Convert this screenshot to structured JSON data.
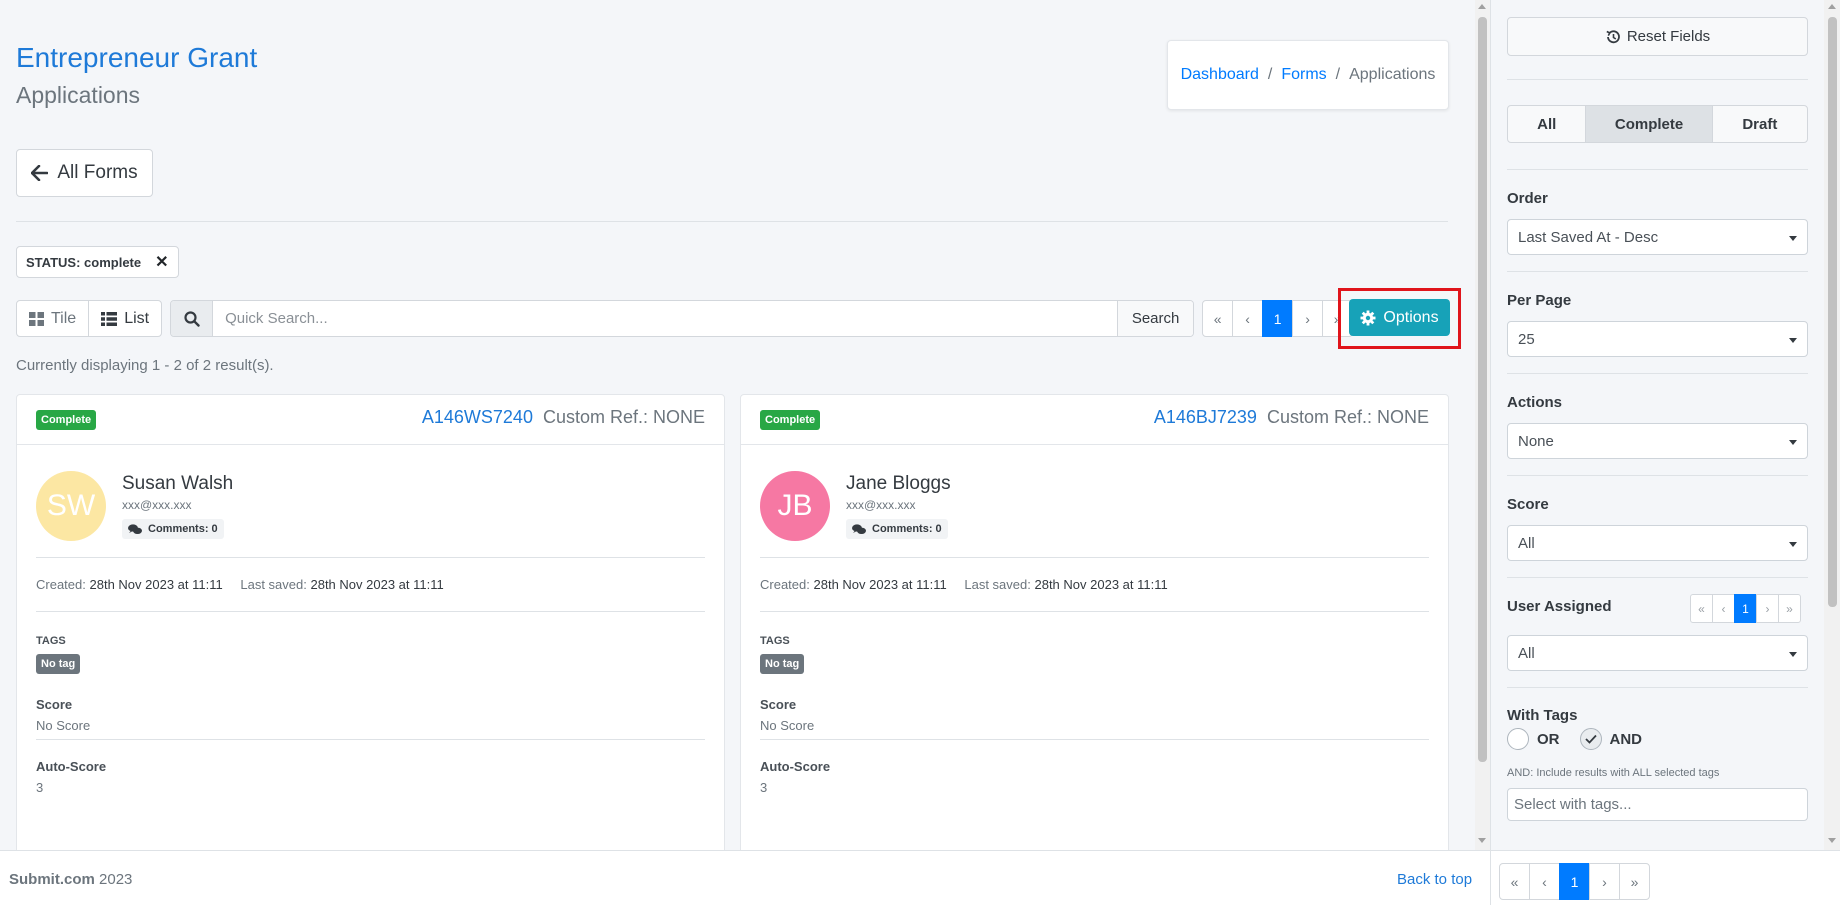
{
  "header": {
    "title": "Entrepreneur Grant",
    "subtitle": "Applications"
  },
  "breadcrumb": {
    "items": [
      "Dashboard",
      "Forms",
      "Applications"
    ]
  },
  "back_button": {
    "label": "All Forms"
  },
  "status_filter": {
    "label": "STATUS:",
    "value": "complete"
  },
  "toolbar": {
    "tile_label": "Tile",
    "list_label": "List",
    "search_placeholder": "Quick Search...",
    "search_button": "Search",
    "options_label": "Options",
    "pager": [
      "«",
      "‹",
      "1",
      "›",
      "»"
    ]
  },
  "results": {
    "summary": "Currently displaying 1 - 2 of 2 result(s)."
  },
  "cards": [
    {
      "status": "Complete",
      "ref": "A146WS7240",
      "custom_ref": "Custom Ref.: NONE",
      "initials": "SW",
      "avatar_color": "#fce7a3",
      "name": "Susan Walsh",
      "email": "xxx@xxx.xxx",
      "comments": "Comments: 0",
      "created_label": "Created:",
      "created": "28th Nov 2023 at 11:11",
      "saved_label": "Last saved:",
      "saved": "28th Nov 2023 at 11:11",
      "tags_label": "TAGS",
      "tag": "No tag",
      "score_label": "Score",
      "score": "No Score",
      "auto_score_label": "Auto-Score",
      "auto_score": "3"
    },
    {
      "status": "Complete",
      "ref": "A146BJ7239",
      "custom_ref": "Custom Ref.: NONE",
      "initials": "JB",
      "avatar_color": "#f678a3",
      "name": "Jane Bloggs",
      "email": "xxx@xxx.xxx",
      "comments": "Comments: 0",
      "created_label": "Created:",
      "created": "28th Nov 2023 at 11:11",
      "saved_label": "Last saved:",
      "saved": "28th Nov 2023 at 11:11",
      "tags_label": "TAGS",
      "tag": "No tag",
      "score_label": "Score",
      "score": "No Score",
      "auto_score_label": "Auto-Score",
      "auto_score": "3"
    }
  ],
  "footer": {
    "brand": "Submit.com",
    "year": "2023",
    "back_to_top": "Back to top"
  },
  "sidebar": {
    "reset_label": "Reset Fields",
    "segments": [
      "All",
      "Complete",
      "Draft"
    ],
    "active_segment": "Complete",
    "order_label": "Order",
    "order_value": "Last Saved At - Desc",
    "per_page_label": "Per Page",
    "per_page_value": "25",
    "actions_label": "Actions",
    "actions_value": "None",
    "score_label": "Score",
    "score_value": "All",
    "user_assigned_label": "User Assigned",
    "user_assigned_value": "All",
    "user_pager": [
      "«",
      "‹",
      "1",
      "›",
      "»"
    ],
    "with_tags_label": "With Tags",
    "or_label": "OR",
    "and_label": "AND",
    "selected_logic": "AND",
    "tags_help": "AND: Include results with ALL selected tags",
    "tags_placeholder": "Select with tags...",
    "bottom_pager": [
      "«",
      "‹",
      "1",
      "›",
      "»"
    ]
  },
  "colors": {
    "primary": "#007bff",
    "info": "#17a2b8",
    "success": "#28a745",
    "secondary": "#6c757d",
    "highlight": "#e0141b"
  }
}
